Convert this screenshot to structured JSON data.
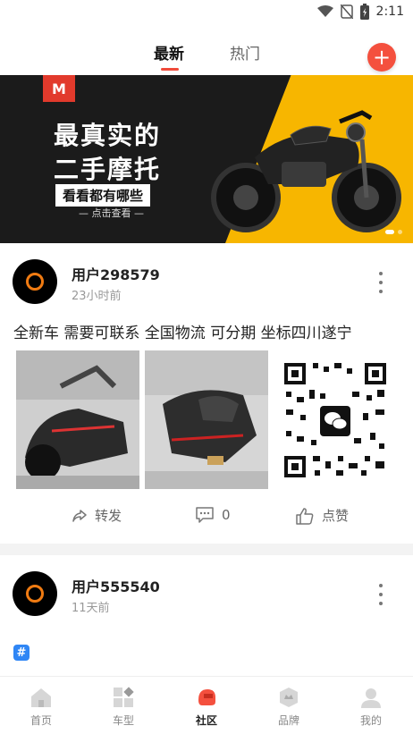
{
  "status_bar": {
    "time": "2:11"
  },
  "tabs": {
    "latest": "最新",
    "hot": "热门"
  },
  "banner": {
    "logo": "M",
    "title_line1": "最真实的",
    "title_line2": "二手摩托",
    "subtitle": "看看都有哪些",
    "cta": "— 点击查看 —"
  },
  "posts": [
    {
      "username": "用户298579",
      "time": "23小时前",
      "content": "全新车 需要可联系  全国物流  可分期 坐标四川遂宁",
      "share_label": "转发",
      "comment_count": "0",
      "like_label": "点赞"
    },
    {
      "username": "用户555540",
      "time": "11天前",
      "tag_icon": "#"
    }
  ],
  "bottom_nav": [
    {
      "label": "首页",
      "icon": "home-icon"
    },
    {
      "label": "车型",
      "icon": "models-icon"
    },
    {
      "label": "社区",
      "icon": "community-icon"
    },
    {
      "label": "品牌",
      "icon": "brand-icon"
    },
    {
      "label": "我的",
      "icon": "profile-icon"
    }
  ],
  "colors": {
    "accent": "#f4503e",
    "banner_yellow": "#f7b600",
    "badge_blue": "#2f86f5"
  }
}
